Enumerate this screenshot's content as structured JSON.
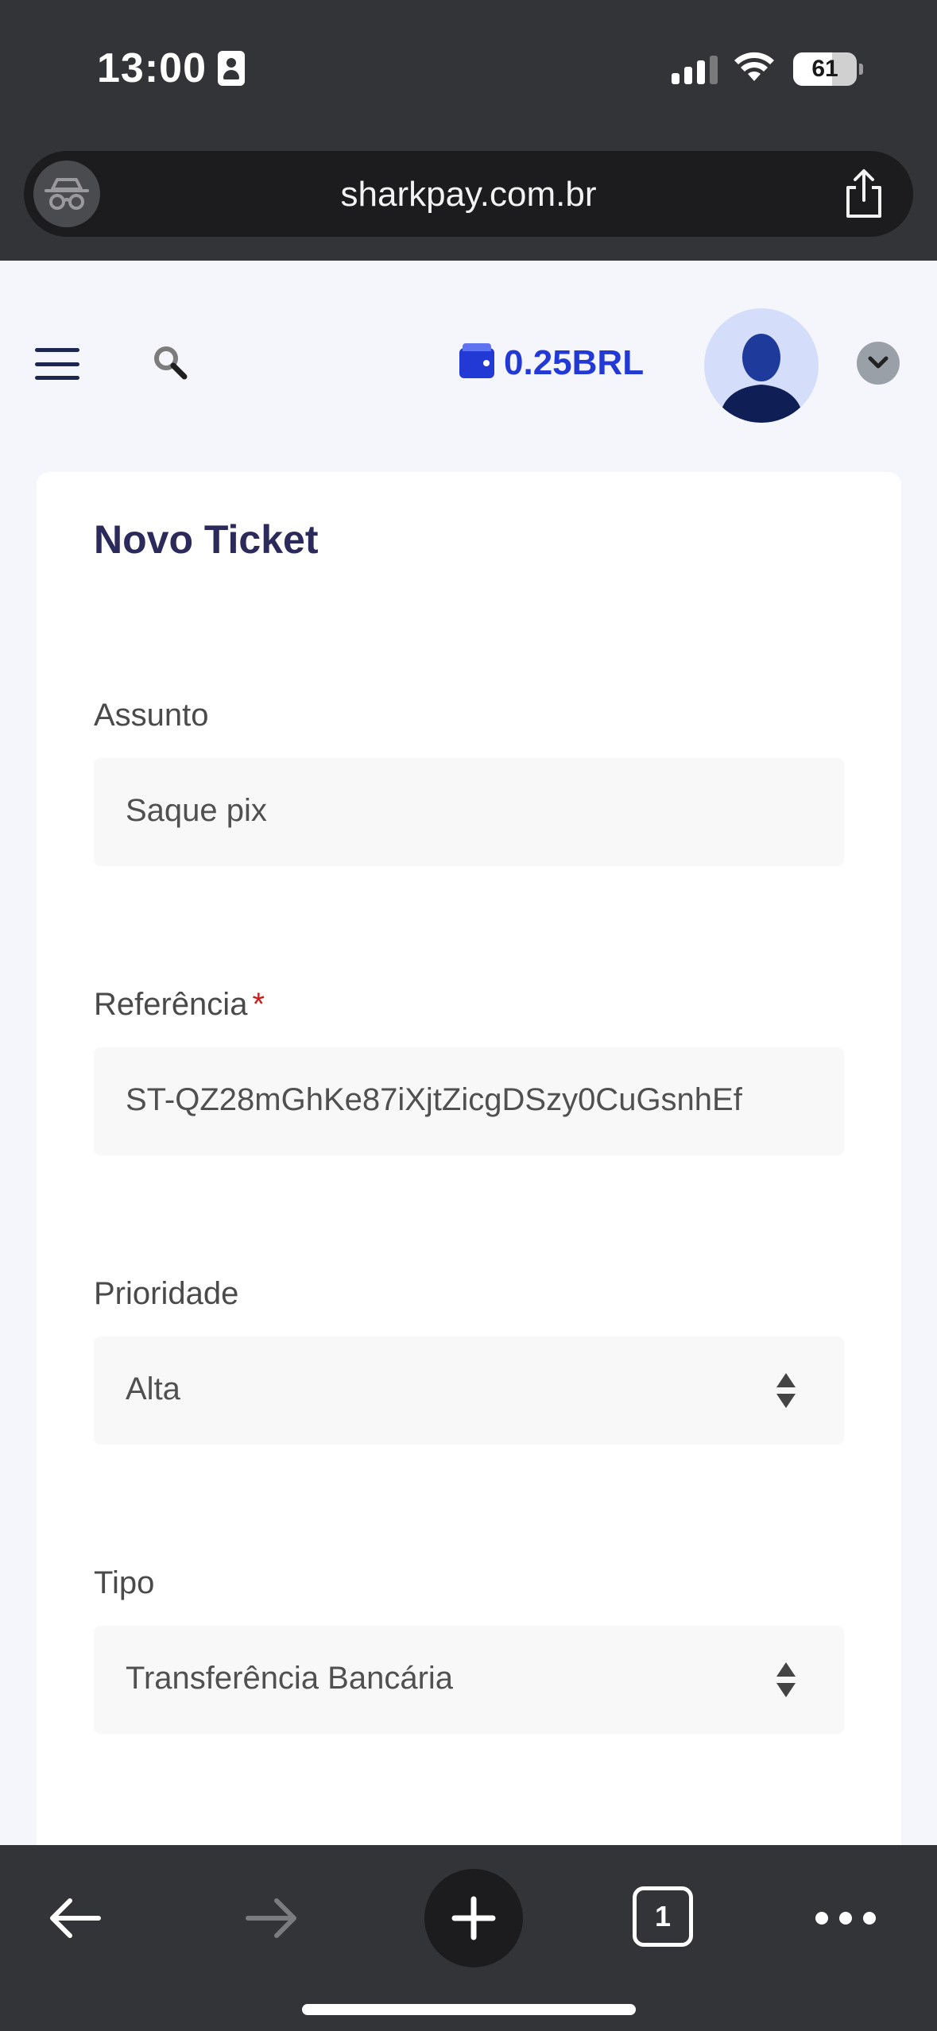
{
  "status_bar": {
    "time": "13:00",
    "battery": "61",
    "battery_level": 0.61
  },
  "browser": {
    "url": "sharkpay.com.br"
  },
  "header": {
    "balance": "0.25BRL"
  },
  "form": {
    "title": "Novo Ticket",
    "subject": {
      "label": "Assunto",
      "value": "Saque pix"
    },
    "reference": {
      "label": "Referência",
      "required_mark": "*",
      "value": "ST-QZ28mGhKe87iXjtZicgDSzy0CuGsnhEf"
    },
    "priority": {
      "label": "Prioridade",
      "value": "Alta"
    },
    "type": {
      "label": "Tipo",
      "value": "Transferência Bancária"
    }
  },
  "toolbar": {
    "tab_count": "1"
  },
  "colors": {
    "accent": "#2239d6",
    "title": "#2b2a5b",
    "required": "#d11a1a",
    "chrome": "#323438"
  }
}
